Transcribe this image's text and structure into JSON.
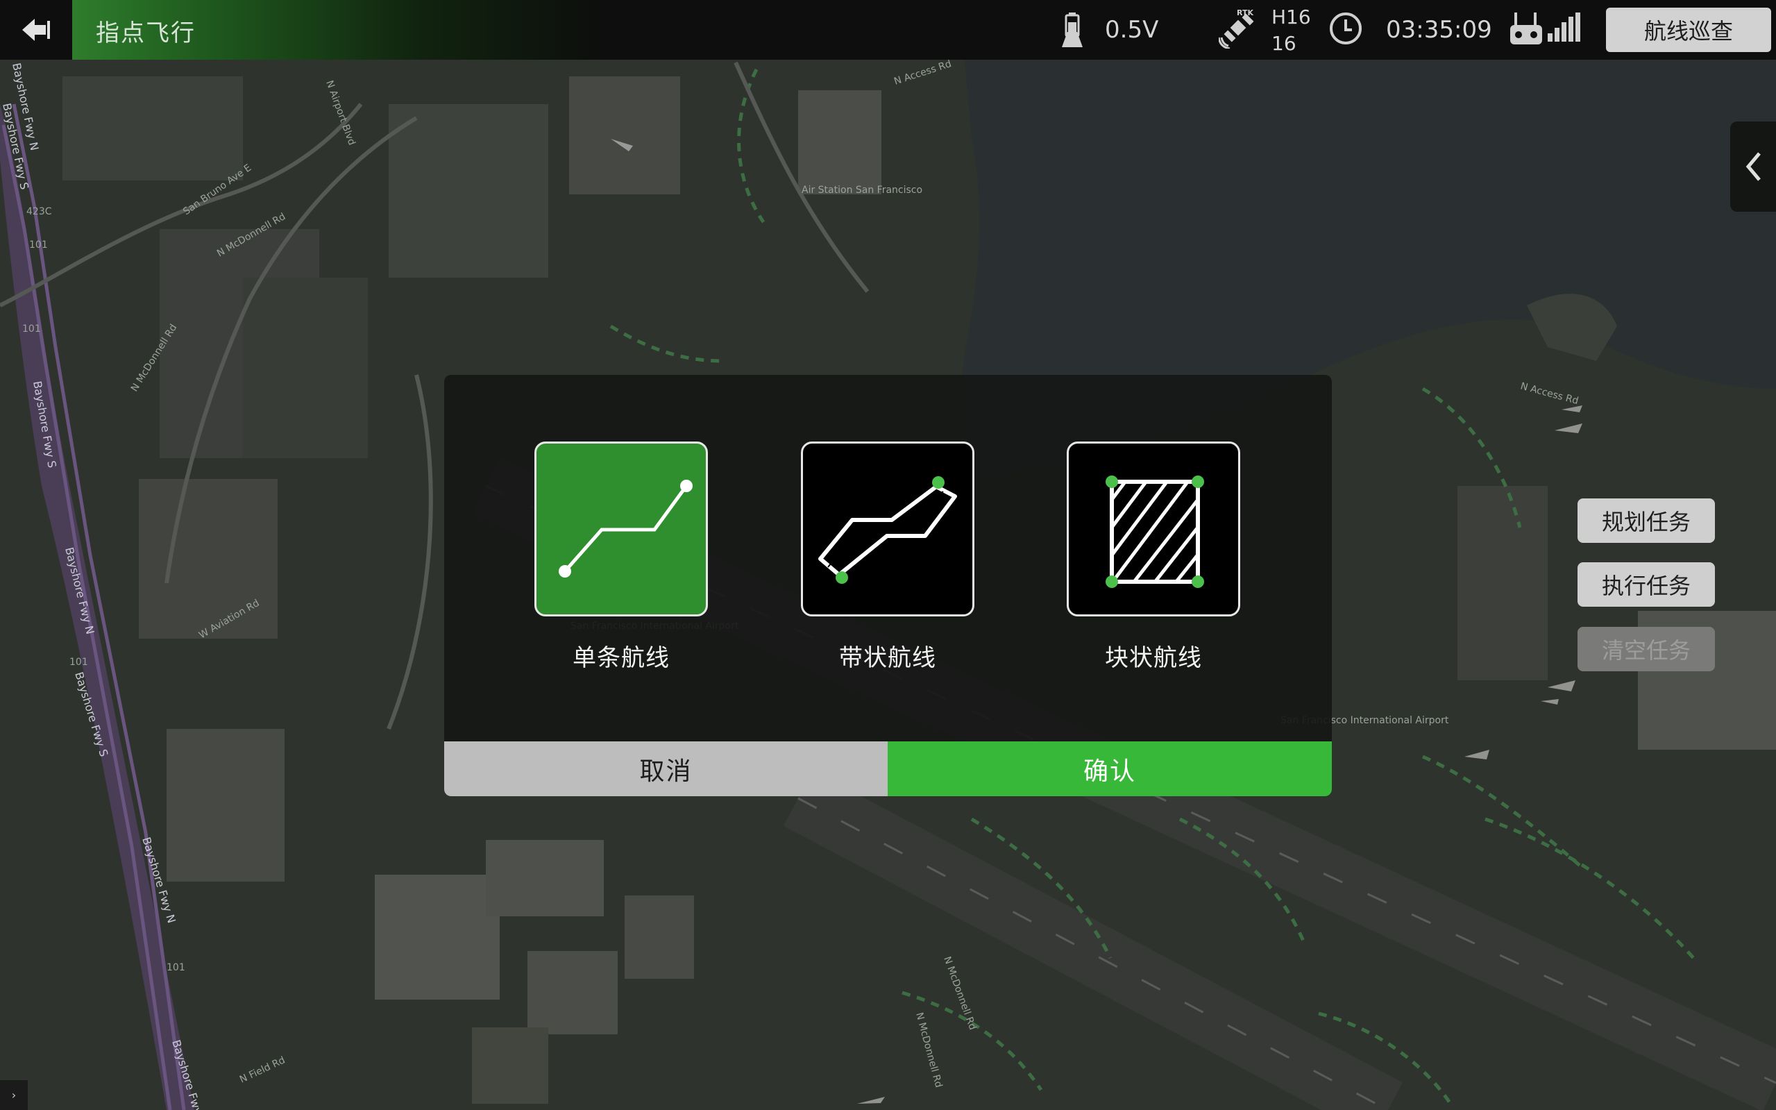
{
  "app": {
    "title": "指点飞行"
  },
  "status": {
    "battery_voltage": "0.5V",
    "rtk_label": "RTK",
    "rtk_satellite_type": "H16",
    "rtk_satellite_count": "16",
    "flight_time": "03:35:09"
  },
  "header": {
    "route_inspect_label": "航线巡查"
  },
  "side_panel": {
    "plan_task": "规划任务",
    "execute_task": "执行任务",
    "clear_task": "清空任务"
  },
  "dialog": {
    "options": [
      {
        "label": "单条航线",
        "icon": "single-route-icon",
        "selected": true
      },
      {
        "label": "带状航线",
        "icon": "strip-route-icon",
        "selected": false
      },
      {
        "label": "块状航线",
        "icon": "block-route-icon",
        "selected": false
      }
    ],
    "cancel_label": "取消",
    "confirm_label": "确认"
  },
  "map": {
    "labels": [
      "Bayshore Fwy N",
      "Bayshore Fwy S",
      "N McDonnell Rd",
      "San Bruno Ave E",
      "Air Station San Francisco",
      "San Francisco International Airport",
      "N Access Rd",
      "W Aviation Rd",
      "N Field Rd",
      "N Airport Blvd",
      "101",
      "423C"
    ]
  },
  "colors": {
    "accent_green": "#38b838",
    "selected_green": "#2f8f2f",
    "topbar": "#0d0e0d",
    "map_waypoint_green": "#4bc04b"
  }
}
